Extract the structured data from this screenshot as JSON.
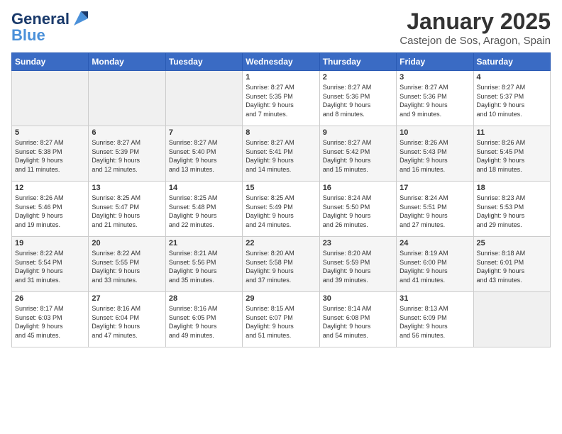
{
  "header": {
    "logo_line1": "General",
    "logo_line2": "Blue",
    "month_title": "January 2025",
    "location": "Castejon de Sos, Aragon, Spain"
  },
  "weekdays": [
    "Sunday",
    "Monday",
    "Tuesday",
    "Wednesday",
    "Thursday",
    "Friday",
    "Saturday"
  ],
  "weeks": [
    [
      {
        "day": "",
        "info": ""
      },
      {
        "day": "",
        "info": ""
      },
      {
        "day": "",
        "info": ""
      },
      {
        "day": "1",
        "info": "Sunrise: 8:27 AM\nSunset: 5:35 PM\nDaylight: 9 hours\nand 7 minutes."
      },
      {
        "day": "2",
        "info": "Sunrise: 8:27 AM\nSunset: 5:36 PM\nDaylight: 9 hours\nand 8 minutes."
      },
      {
        "day": "3",
        "info": "Sunrise: 8:27 AM\nSunset: 5:36 PM\nDaylight: 9 hours\nand 9 minutes."
      },
      {
        "day": "4",
        "info": "Sunrise: 8:27 AM\nSunset: 5:37 PM\nDaylight: 9 hours\nand 10 minutes."
      }
    ],
    [
      {
        "day": "5",
        "info": "Sunrise: 8:27 AM\nSunset: 5:38 PM\nDaylight: 9 hours\nand 11 minutes."
      },
      {
        "day": "6",
        "info": "Sunrise: 8:27 AM\nSunset: 5:39 PM\nDaylight: 9 hours\nand 12 minutes."
      },
      {
        "day": "7",
        "info": "Sunrise: 8:27 AM\nSunset: 5:40 PM\nDaylight: 9 hours\nand 13 minutes."
      },
      {
        "day": "8",
        "info": "Sunrise: 8:27 AM\nSunset: 5:41 PM\nDaylight: 9 hours\nand 14 minutes."
      },
      {
        "day": "9",
        "info": "Sunrise: 8:27 AM\nSunset: 5:42 PM\nDaylight: 9 hours\nand 15 minutes."
      },
      {
        "day": "10",
        "info": "Sunrise: 8:26 AM\nSunset: 5:43 PM\nDaylight: 9 hours\nand 16 minutes."
      },
      {
        "day": "11",
        "info": "Sunrise: 8:26 AM\nSunset: 5:45 PM\nDaylight: 9 hours\nand 18 minutes."
      }
    ],
    [
      {
        "day": "12",
        "info": "Sunrise: 8:26 AM\nSunset: 5:46 PM\nDaylight: 9 hours\nand 19 minutes."
      },
      {
        "day": "13",
        "info": "Sunrise: 8:25 AM\nSunset: 5:47 PM\nDaylight: 9 hours\nand 21 minutes."
      },
      {
        "day": "14",
        "info": "Sunrise: 8:25 AM\nSunset: 5:48 PM\nDaylight: 9 hours\nand 22 minutes."
      },
      {
        "day": "15",
        "info": "Sunrise: 8:25 AM\nSunset: 5:49 PM\nDaylight: 9 hours\nand 24 minutes."
      },
      {
        "day": "16",
        "info": "Sunrise: 8:24 AM\nSunset: 5:50 PM\nDaylight: 9 hours\nand 26 minutes."
      },
      {
        "day": "17",
        "info": "Sunrise: 8:24 AM\nSunset: 5:51 PM\nDaylight: 9 hours\nand 27 minutes."
      },
      {
        "day": "18",
        "info": "Sunrise: 8:23 AM\nSunset: 5:53 PM\nDaylight: 9 hours\nand 29 minutes."
      }
    ],
    [
      {
        "day": "19",
        "info": "Sunrise: 8:22 AM\nSunset: 5:54 PM\nDaylight: 9 hours\nand 31 minutes."
      },
      {
        "day": "20",
        "info": "Sunrise: 8:22 AM\nSunset: 5:55 PM\nDaylight: 9 hours\nand 33 minutes."
      },
      {
        "day": "21",
        "info": "Sunrise: 8:21 AM\nSunset: 5:56 PM\nDaylight: 9 hours\nand 35 minutes."
      },
      {
        "day": "22",
        "info": "Sunrise: 8:20 AM\nSunset: 5:58 PM\nDaylight: 9 hours\nand 37 minutes."
      },
      {
        "day": "23",
        "info": "Sunrise: 8:20 AM\nSunset: 5:59 PM\nDaylight: 9 hours\nand 39 minutes."
      },
      {
        "day": "24",
        "info": "Sunrise: 8:19 AM\nSunset: 6:00 PM\nDaylight: 9 hours\nand 41 minutes."
      },
      {
        "day": "25",
        "info": "Sunrise: 8:18 AM\nSunset: 6:01 PM\nDaylight: 9 hours\nand 43 minutes."
      }
    ],
    [
      {
        "day": "26",
        "info": "Sunrise: 8:17 AM\nSunset: 6:03 PM\nDaylight: 9 hours\nand 45 minutes."
      },
      {
        "day": "27",
        "info": "Sunrise: 8:16 AM\nSunset: 6:04 PM\nDaylight: 9 hours\nand 47 minutes."
      },
      {
        "day": "28",
        "info": "Sunrise: 8:16 AM\nSunset: 6:05 PM\nDaylight: 9 hours\nand 49 minutes."
      },
      {
        "day": "29",
        "info": "Sunrise: 8:15 AM\nSunset: 6:07 PM\nDaylight: 9 hours\nand 51 minutes."
      },
      {
        "day": "30",
        "info": "Sunrise: 8:14 AM\nSunset: 6:08 PM\nDaylight: 9 hours\nand 54 minutes."
      },
      {
        "day": "31",
        "info": "Sunrise: 8:13 AM\nSunset: 6:09 PM\nDaylight: 9 hours\nand 56 minutes."
      },
      {
        "day": "",
        "info": ""
      }
    ]
  ]
}
